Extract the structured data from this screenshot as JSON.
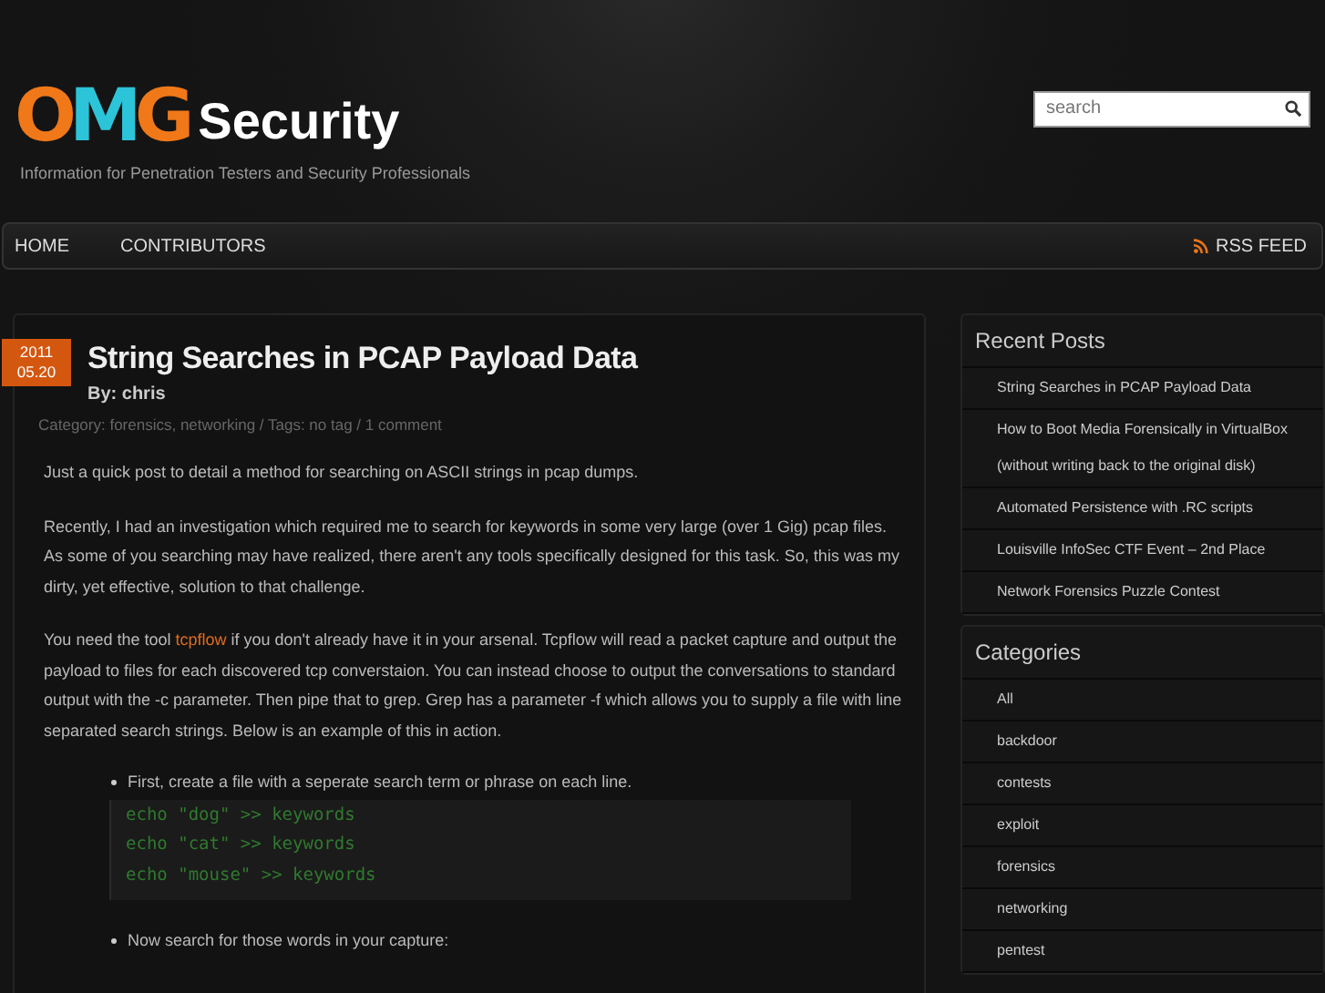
{
  "logo": {
    "letters": [
      {
        "char": "O",
        "color": "#f07818"
      },
      {
        "char": "M",
        "color": "#2cc4d8"
      },
      {
        "char": "G",
        "color": "#f07818"
      }
    ],
    "word": "Security"
  },
  "tagline": "Information for Penetration Testers and Security Professionals",
  "search": {
    "placeholder": "search"
  },
  "nav": {
    "items": [
      {
        "label": "HOME"
      },
      {
        "label": "CONTRIBUTORS"
      }
    ],
    "rss": "RSS FEED"
  },
  "post": {
    "year": "2011",
    "date": "05.20",
    "title": "String Searches in PCAP Payload Data",
    "author": "By: chris",
    "meta": "Category: forensics, networking / Tags: no tag / 1 comment",
    "paragraphs": [
      {
        "before": "Just a quick post to detail a method for searching on ASCII strings in pcap dumps."
      },
      {
        "before": "Recently, I had an investigation which required me to search for keywords in some very large (over 1 Gig) pcap files. As some of you searching may have realized, there aren't any tools specifically designed for this task. So, this was my dirty, yet effective, solution to that challenge."
      },
      {
        "before": "You need the tool ",
        "link": "tcpflow",
        "after": " if you don't already have it in your arsenal. Tcpflow will read a packet capture and output the payload to files for each discovered tcp converstaion. You can instead choose to output the conversations to standard output with the -c parameter. Then pipe that to grep. Grep has a parameter -f which allows you to supply a file with line separated search strings. Below is an example of this in action."
      }
    ],
    "steps": [
      {
        "text": "First, create a file with a seperate search term or phrase on each line.",
        "code": [
          "echo \"dog\" >> keywords",
          "echo \"cat\" >> keywords",
          "echo \"mouse\" >> keywords"
        ]
      },
      {
        "text": "Now search for those words in your capture:"
      }
    ]
  },
  "sidebar": [
    {
      "title": "Recent Posts",
      "items": [
        "String Searches in PCAP Payload Data",
        "How to Boot Media Forensically in VirtualBox (without writing back to the original disk)",
        "Automated Persistence with .RC scripts",
        "Louisville InfoSec CTF Event – 2nd Place",
        "Network Forensics Puzzle Contest"
      ]
    },
    {
      "title": "Categories",
      "items": [
        "All",
        "backdoor",
        "contests",
        "exploit",
        "forensics",
        "networking",
        "pentest"
      ]
    }
  ]
}
